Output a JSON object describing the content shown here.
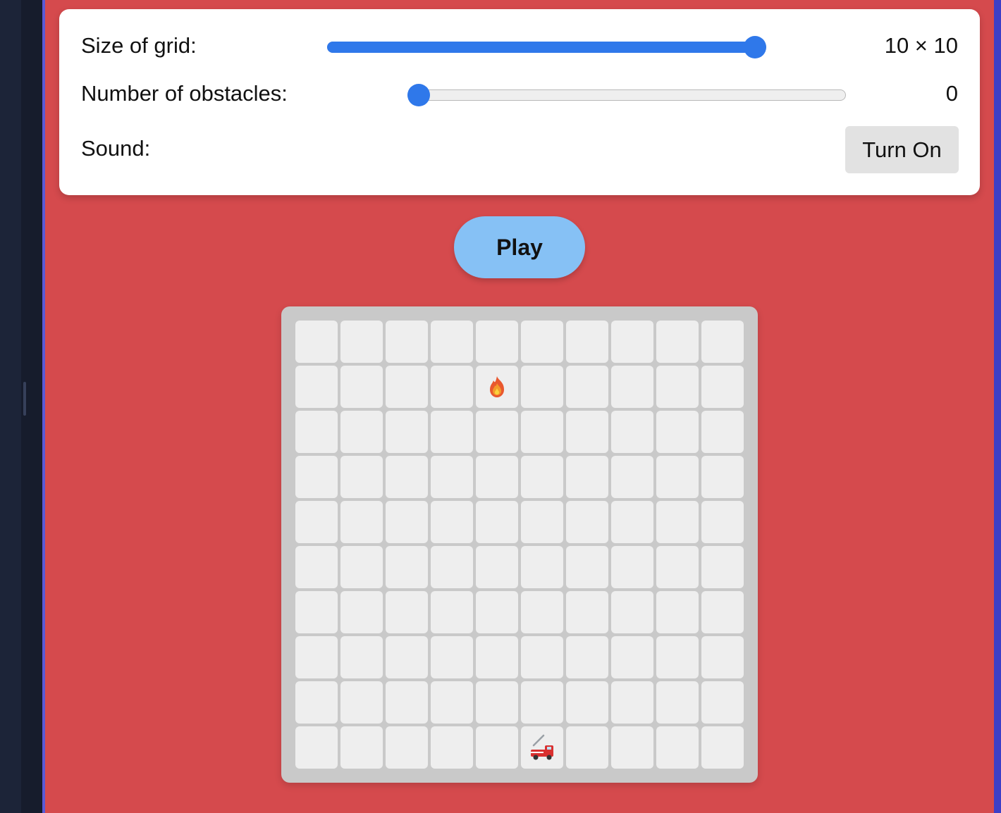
{
  "settings": {
    "grid_size": {
      "label": "Size of grid:",
      "value_text": "10 × 10",
      "level": 1.0
    },
    "obstacles": {
      "label": "Number of obstacles:",
      "value_text": "0",
      "level": 0.0
    },
    "sound": {
      "label": "Sound:",
      "button_label": "Turn On"
    }
  },
  "play_label": "Play",
  "board": {
    "rows": 10,
    "cols": 10,
    "items": [
      {
        "icon": "fire-icon",
        "row": 1,
        "col": 4
      },
      {
        "icon": "fire-truck-icon",
        "row": 9,
        "col": 5
      }
    ]
  },
  "colors": {
    "background": "#d54a4d",
    "slider_accent": "#2f78ea",
    "play_button": "#86c1f5"
  }
}
